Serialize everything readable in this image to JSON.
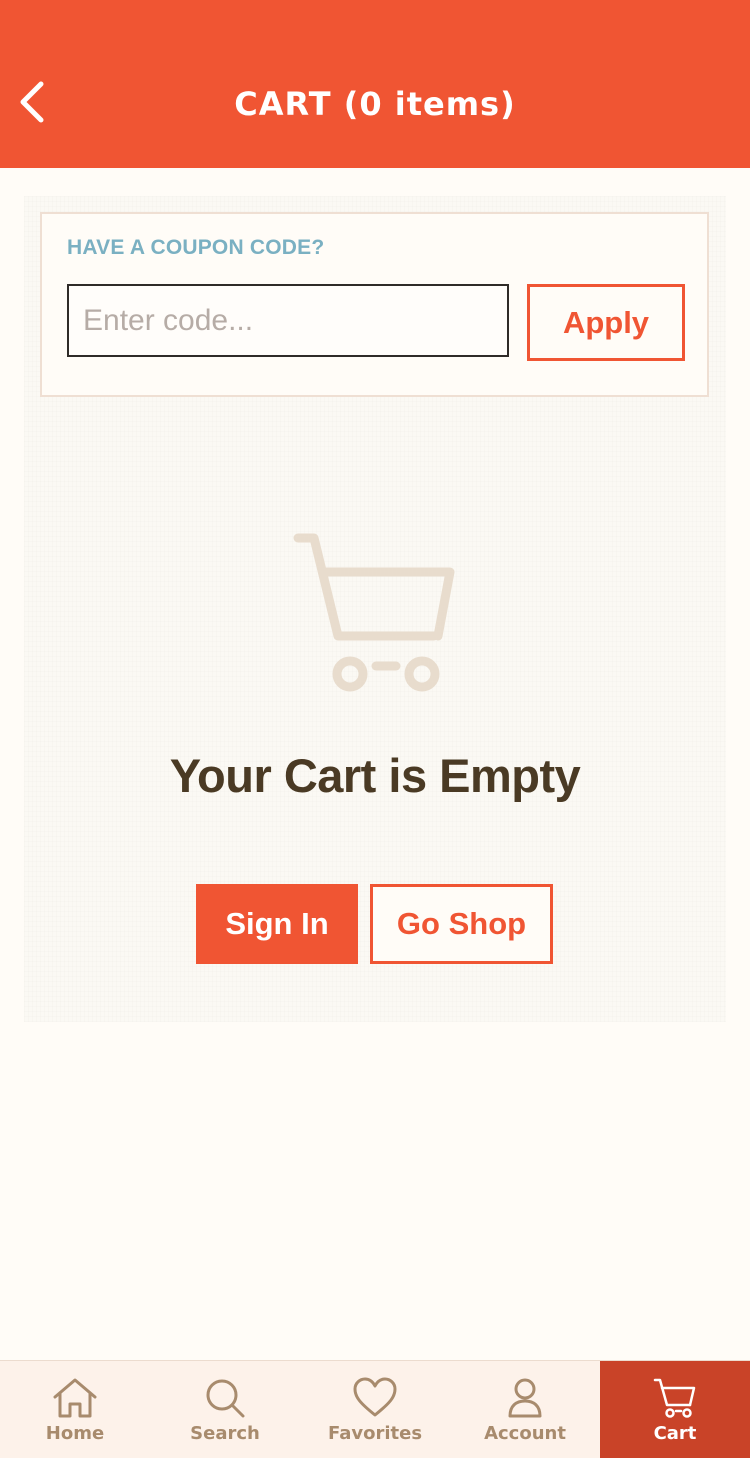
{
  "header": {
    "title": "CART (0 items)"
  },
  "coupon": {
    "label": "HAVE A COUPON CODE?",
    "placeholder": "Enter code...",
    "value": "",
    "apply_label": "Apply"
  },
  "empty_state": {
    "icon": "cart-icon",
    "title": "Your Cart is Empty",
    "sign_in_label": "Sign In",
    "go_shop_label": "Go Shop"
  },
  "tabbar": {
    "tabs": [
      {
        "label": "Home",
        "icon": "home-icon"
      },
      {
        "label": "Search",
        "icon": "search-icon"
      },
      {
        "label": "Favorites",
        "icon": "heart-icon"
      },
      {
        "label": "Account",
        "icon": "user-icon"
      },
      {
        "label": "Cart",
        "icon": "cart-icon",
        "active": true
      }
    ]
  },
  "colors": {
    "brand": "#f05533",
    "active_tab": "#c94328",
    "tab_text": "#a88b6d",
    "coupon_label": "#7ab0c2",
    "title_text": "#4a3a24",
    "background": "#fffcf7"
  }
}
